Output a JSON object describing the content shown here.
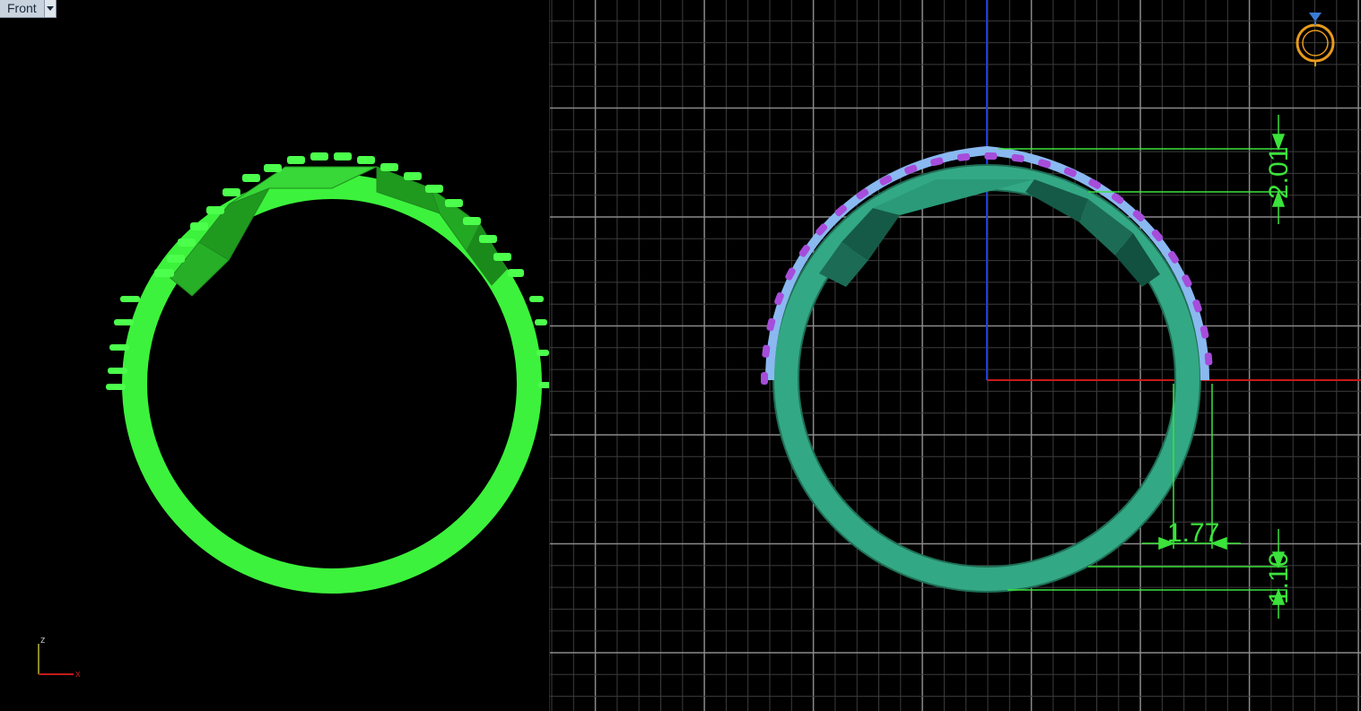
{
  "viewport_left": {
    "view_name": "Front",
    "axis_labels": {
      "z": "z",
      "x": "x"
    }
  },
  "viewport_right": {
    "dimensions": {
      "top_height": "2.01",
      "width": "1.77",
      "bottom_height": "1.10"
    },
    "nav_icon": "ring-navigator-icon"
  },
  "colors": {
    "ring_left": "#3cf23c",
    "ring_right": "#33a884",
    "stones": "#a64ddb",
    "dimension": "#3be33b",
    "axis_x": "#c41a1a",
    "axis_y": "#1f3fd6",
    "grid": "#5a5a5a"
  }
}
